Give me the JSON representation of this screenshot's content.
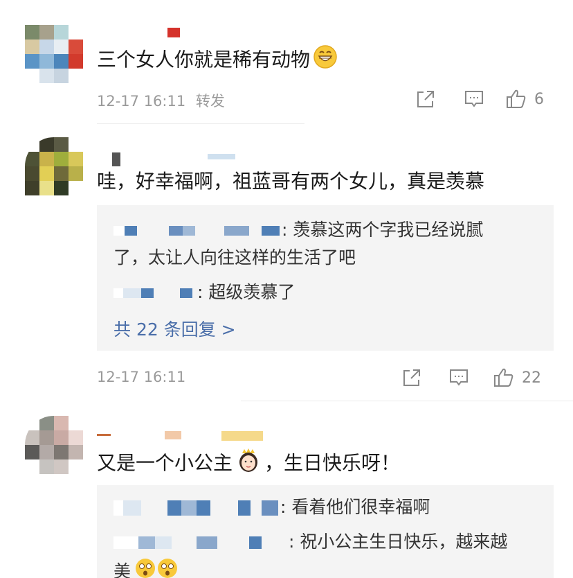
{
  "comments": [
    {
      "text": "三个女人你就是稀有动物",
      "emoji": "grinning-face-emoji",
      "timestamp": "12-17 16:11",
      "repost_label": "转发",
      "like_count": "6"
    },
    {
      "text": "哇，好幸福啊，祖蓝哥有两个女儿，真是羡慕",
      "timestamp": "12-17 16:11",
      "like_count": "22",
      "replies": [
        {
          "text": ": 羡慕这两个字我已经说腻",
          "text_cont": "了，太让人向往这样的生活了吧"
        },
        {
          "text": ": 超级羡慕了"
        }
      ],
      "more_replies": "共 22 条回复 >"
    },
    {
      "text": "又是一个小公主",
      "emoji": "princess-emoji",
      "text_after": "，生日快乐呀！",
      "replies": [
        {
          "text": ": 看着他们很幸福啊"
        },
        {
          "text": ": 祝小公主生日快乐，越来越",
          "text_cont": "美",
          "emoji": "flushed-face-emoji"
        }
      ]
    }
  ],
  "colors": {
    "link_blue": "#4a6ea9",
    "meta_gray": "#9a9a9a",
    "reply_bg": "#f4f4f4",
    "blur_blue": "#4f7fb6"
  }
}
